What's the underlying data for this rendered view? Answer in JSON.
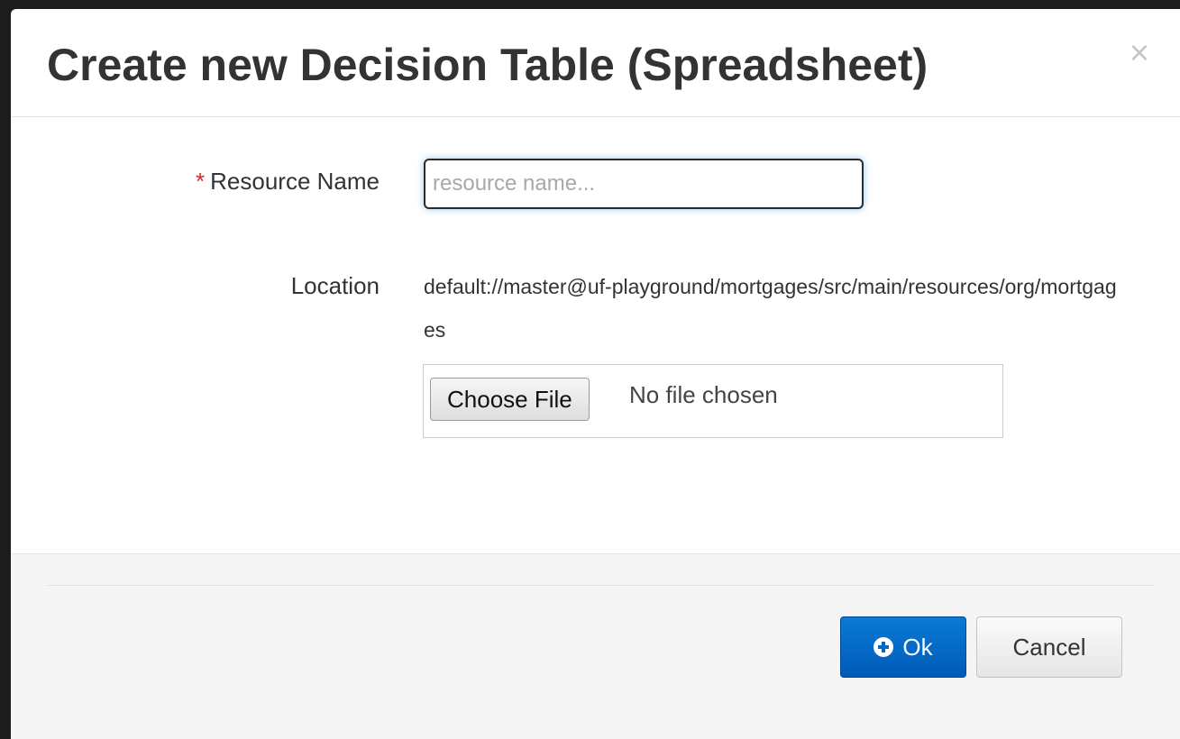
{
  "dialog": {
    "title": "Create new Decision Table (Spreadsheet)",
    "close_symbol": "×",
    "close_icon": "close-icon"
  },
  "form": {
    "resource_name": {
      "required_marker": "*",
      "label": "Resource Name",
      "value": "",
      "placeholder": "resource name..."
    },
    "location": {
      "label": "Location",
      "value": "default://master@uf-playground/mortgages/src/main/resources/org/mortgages"
    },
    "file_upload": {
      "button_label": "Choose File",
      "status_text": "No file chosen"
    }
  },
  "footer": {
    "ok_label": "Ok",
    "ok_icon": "plus-circle-icon",
    "cancel_label": "Cancel"
  },
  "colors": {
    "primary_button": "#0066c5",
    "required_marker": "#c9302c",
    "title_text": "#333333"
  }
}
